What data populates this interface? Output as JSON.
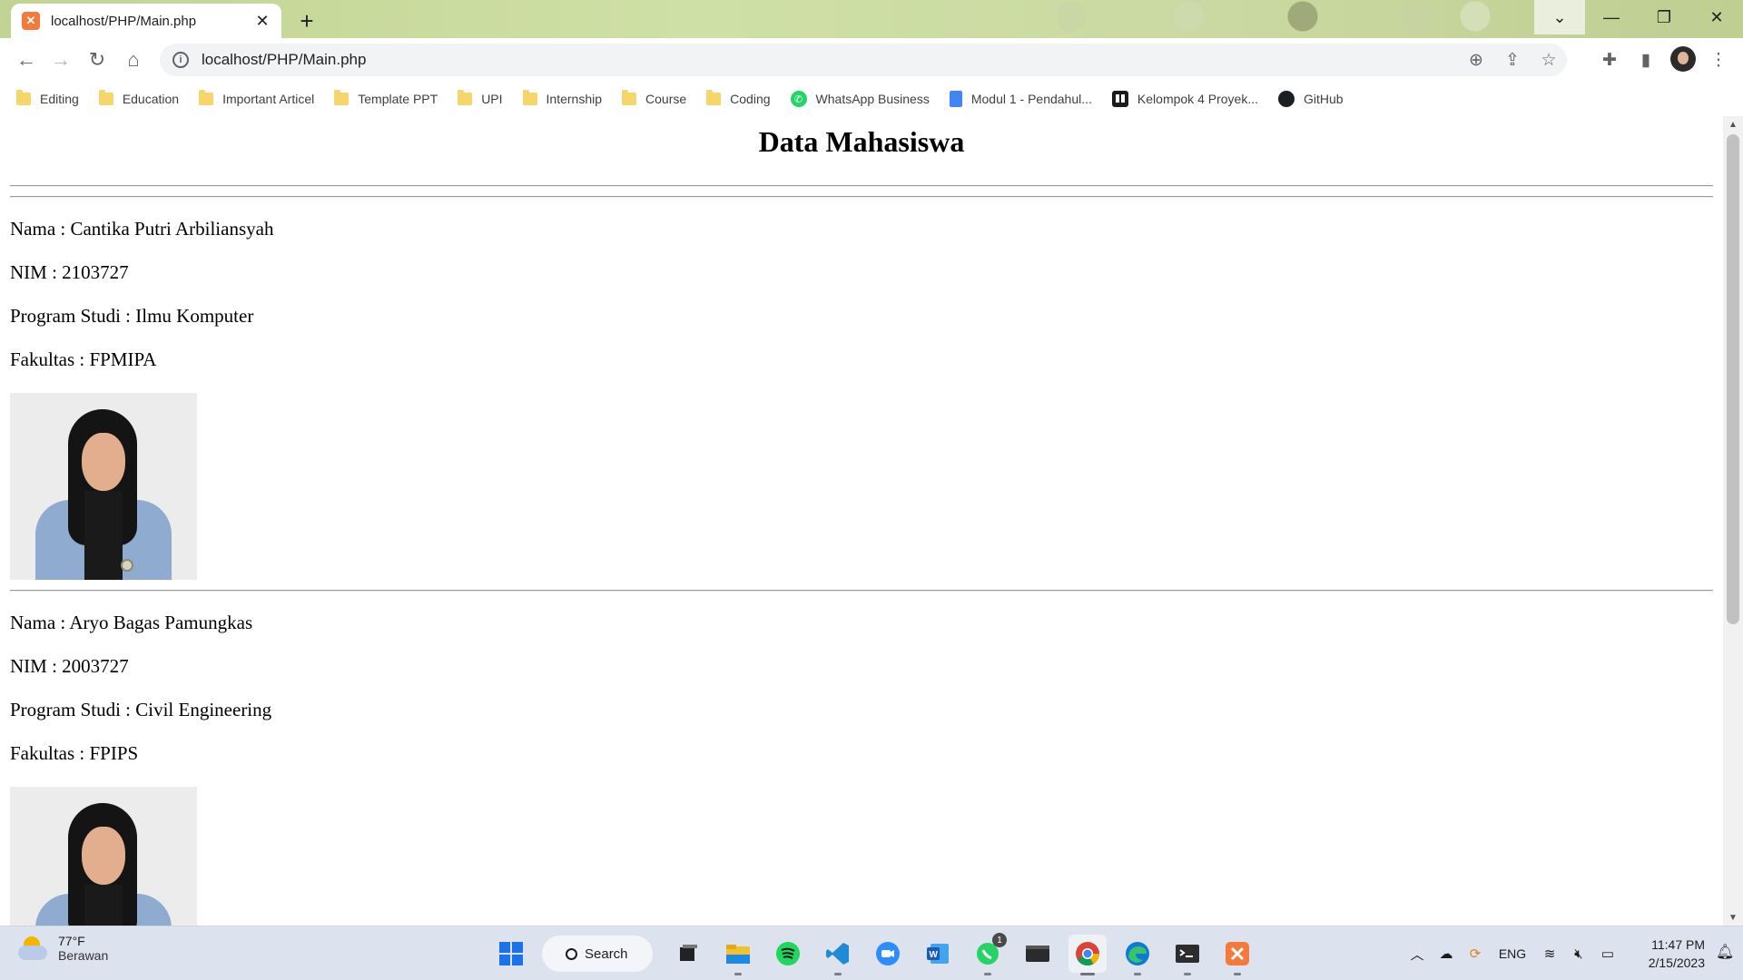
{
  "browser": {
    "tab_title": "localhost/PHP/Main.php",
    "url": "localhost/PHP/Main.php",
    "bookmarks": [
      {
        "label": "Editing",
        "icon": "folder-icon"
      },
      {
        "label": "Education",
        "icon": "folder-icon"
      },
      {
        "label": "Important Articel",
        "icon": "folder-icon"
      },
      {
        "label": "Template PPT",
        "icon": "folder-icon"
      },
      {
        "label": "UPI",
        "icon": "folder-icon"
      },
      {
        "label": "Internship",
        "icon": "folder-icon"
      },
      {
        "label": "Course",
        "icon": "folder-icon"
      },
      {
        "label": "Coding",
        "icon": "folder-icon"
      },
      {
        "label": "WhatsApp Business",
        "icon": "whatsapp-icon"
      },
      {
        "label": "Modul 1 - Pendahul...",
        "icon": "google-docs-icon"
      },
      {
        "label": "Kelompok 4 Proyek...",
        "icon": "trello-icon"
      },
      {
        "label": "GitHub",
        "icon": "github-icon"
      }
    ]
  },
  "page": {
    "title": "Data Mahasiswa",
    "students": [
      {
        "nama": "Nama : Cantika Putri Arbiliansyah",
        "nim": "NIM : 2103727",
        "prodi": "Program Studi : Ilmu Komputer",
        "fakultas": "Fakultas : FPMIPA"
      },
      {
        "nama": "Nama : Aryo Bagas Pamungkas",
        "nim": "NIM : 2003727",
        "prodi": "Program Studi : Civil Engineering",
        "fakultas": "Fakultas : FPIPS"
      }
    ]
  },
  "taskbar": {
    "weather_temp": "77°F",
    "weather_desc": "Berawan",
    "search_label": "Search",
    "whatsapp_badge": "1",
    "language": "ENG",
    "time": "11:47 PM",
    "date": "2/15/2023"
  },
  "colors": {
    "chrome_theme": "#c9d9a1",
    "xampp_orange": "#f37a3b",
    "taskbar_bg": "#dde3ee"
  }
}
